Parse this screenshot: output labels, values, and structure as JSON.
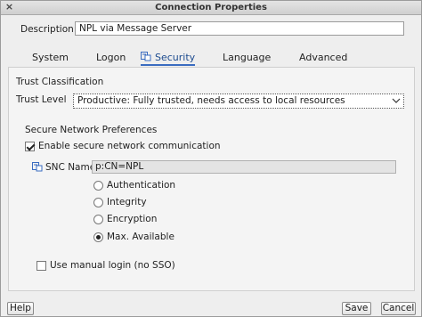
{
  "window": {
    "title": "Connection Properties",
    "close_glyph": "×"
  },
  "description": {
    "label": "Description:",
    "value": "NPL via Message Server"
  },
  "tabs": [
    {
      "label": "System"
    },
    {
      "label": "Logon"
    },
    {
      "label": "Security",
      "icon": "security-icon"
    },
    {
      "label": "Language"
    },
    {
      "label": "Advanced"
    }
  ],
  "active_tab": "Security",
  "trust": {
    "section_title": "Trust Classification",
    "label": "Trust Level",
    "selected": "Productive: Fully trusted, needs access to local resources"
  },
  "snc": {
    "section_title": "Secure Network Preferences",
    "enable_label": "Enable secure network communication",
    "enable_checked": true,
    "name_label": "SNC Name",
    "name_value": "p:CN=NPL",
    "options": [
      {
        "label": "Authentication",
        "checked": false
      },
      {
        "label": "Integrity",
        "checked": false
      },
      {
        "label": "Encryption",
        "checked": false
      },
      {
        "label": "Max. Available",
        "checked": true
      }
    ]
  },
  "manual_login": {
    "label": "Use manual login (no SSO)",
    "checked": false
  },
  "buttons": {
    "help": "Help",
    "save": "Save",
    "cancel": "Cancel"
  },
  "colors": {
    "accent": "#3a6cc0",
    "active_tab_text": "#1c4b8f"
  }
}
